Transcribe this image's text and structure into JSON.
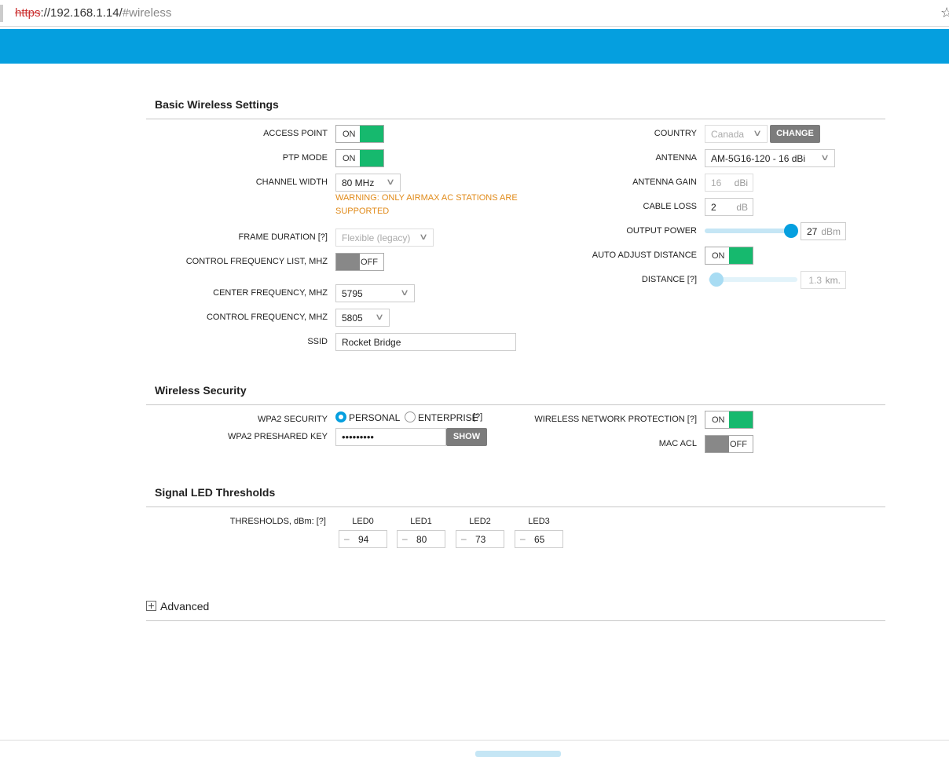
{
  "browser": {
    "url_scheme": "https",
    "url_host": "://192.168.1.14/",
    "url_hash": "#wireless",
    "bookmark_icon": "star-icon"
  },
  "colors": {
    "accent": "#059fdf",
    "toggle_on": "#16b96e",
    "toggle_off": "#888888",
    "warning": "#e08a19"
  },
  "basic": {
    "title": "Basic Wireless Settings",
    "access_point": {
      "label": "ACCESS POINT",
      "state": "ON"
    },
    "ptp_mode": {
      "label": "PTP MODE",
      "state": "ON"
    },
    "channel_width": {
      "label": "CHANNEL WIDTH",
      "value": "80 MHz"
    },
    "warning_line1": "WARNING: ONLY AIRMAX AC STATIONS ARE",
    "warning_line2": "SUPPORTED",
    "frame_duration": {
      "label": "FRAME DURATION [?]",
      "value": "Flexible (legacy)"
    },
    "control_freq_list": {
      "label": "CONTROL FREQUENCY LIST, MHz",
      "state": "OFF"
    },
    "center_freq": {
      "label": "CENTER FREQUENCY, MHz",
      "value": "5795"
    },
    "control_freq": {
      "label": "CONTROL FREQUENCY, MHz",
      "value": "5805"
    },
    "ssid": {
      "label": "SSID",
      "value": "Rocket Bridge"
    },
    "country": {
      "label": "COUNTRY",
      "value": "Canada",
      "button": "CHANGE"
    },
    "antenna": {
      "label": "ANTENNA",
      "value": "AM-5G16-120 - 16 dBi"
    },
    "antenna_gain": {
      "label": "ANTENNA GAIN",
      "value": "16",
      "unit": "dBi"
    },
    "cable_loss": {
      "label": "CABLE LOSS",
      "value": "2",
      "unit": "dB"
    },
    "output_power": {
      "label": "OUTPUT POWER",
      "value": "27",
      "unit": "dBm",
      "slider_fraction": 1.0
    },
    "auto_adjust": {
      "label": "AUTO ADJUST DISTANCE",
      "state": "ON"
    },
    "distance": {
      "label": "DISTANCE [?]",
      "value": "1.3",
      "unit": "km.",
      "slider_fraction": 0.0
    }
  },
  "security": {
    "title": "Wireless Security",
    "wpa2": {
      "label": "WPA2 SECURITY",
      "option1": "PERSONAL",
      "option2": "ENTERPRISE",
      "help": "[?]",
      "selected": "PERSONAL"
    },
    "psk": {
      "label": "WPA2 PRESHARED KEY",
      "value": "•••••••••",
      "button": "SHOW"
    },
    "protection": {
      "label": "WIRELESS NETWORK PROTECTION [?]",
      "state": "ON"
    },
    "mac_acl": {
      "label": "MAC ACL",
      "state": "OFF"
    }
  },
  "led": {
    "title": "Signal LED Thresholds",
    "label": "THRESHOLDS, dBm: [?]",
    "sign": "–",
    "items": [
      {
        "name": "LED0",
        "value": "94"
      },
      {
        "name": "LED1",
        "value": "80"
      },
      {
        "name": "LED2",
        "value": "73"
      },
      {
        "name": "LED3",
        "value": "65"
      }
    ]
  },
  "advanced": {
    "title": "Advanced",
    "icon": "plus-box-icon"
  }
}
